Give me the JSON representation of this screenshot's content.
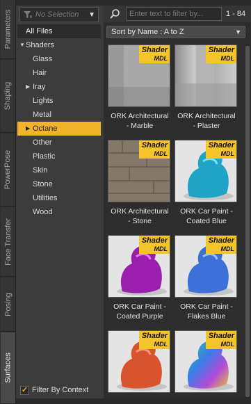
{
  "side_tabs": [
    {
      "label": "Parameters",
      "active": false
    },
    {
      "label": "Shaping",
      "active": false
    },
    {
      "label": "PowerPose",
      "active": false
    },
    {
      "label": "Face Transfer",
      "active": false
    },
    {
      "label": "Posing",
      "active": false
    },
    {
      "label": "Surfaces",
      "active": true
    }
  ],
  "category_filter": {
    "placeholder_text": "No Selection"
  },
  "tree": {
    "all_files": "All Files",
    "root": "Shaders",
    "children": [
      "Glass",
      "Hair",
      "Iray",
      "Lights",
      "Metal",
      "Octane",
      "Other",
      "Plastic",
      "Skin",
      "Stone",
      "Utilities",
      "Wood"
    ],
    "selected": "Octane"
  },
  "filter_by_context": {
    "label": "Filter By Context",
    "checked": true
  },
  "search": {
    "placeholder": "Enter text to filter by...",
    "count": "1 - 84"
  },
  "sort": {
    "label": "Sort by Name : A to Z"
  },
  "badge": {
    "line1": "Shader",
    "line2": "MDL"
  },
  "assets": [
    {
      "line1": "ORK Architectural",
      "line2": "- Marble"
    },
    {
      "line1": "ORK Architectural",
      "line2": "- Plaster"
    },
    {
      "line1": "ORK Architectural",
      "line2": "- Stone"
    },
    {
      "line1": "ORK Car Paint -",
      "line2": "Coated Blue"
    },
    {
      "line1": "ORK Car Paint -",
      "line2": "Coated Purple"
    },
    {
      "line1": "ORK Car Paint -",
      "line2": "Flakes Blue"
    },
    {
      "line1": "",
      "line2": ""
    },
    {
      "line1": "",
      "line2": ""
    }
  ],
  "colors": {
    "accent": "#f0b32a",
    "badge": "#f3c52a"
  }
}
